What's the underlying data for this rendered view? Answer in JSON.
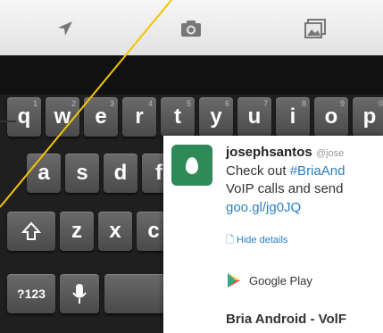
{
  "toolbar": {
    "icons": [
      "location-arrow-icon",
      "camera-icon",
      "gallery-icon"
    ]
  },
  "keyboard": {
    "row1": [
      {
        "label": "q",
        "hint": "1"
      },
      {
        "label": "w",
        "hint": "2"
      },
      {
        "label": "e",
        "hint": "3"
      },
      {
        "label": "r",
        "hint": "4"
      },
      {
        "label": "t",
        "hint": "5"
      },
      {
        "label": "y",
        "hint": "6"
      },
      {
        "label": "u",
        "hint": "7"
      },
      {
        "label": "i",
        "hint": "8"
      },
      {
        "label": "o",
        "hint": "9"
      },
      {
        "label": "p",
        "hint": "0"
      }
    ],
    "row2": [
      "a",
      "s",
      "d",
      "f"
    ],
    "row3": [
      "z",
      "x",
      "c"
    ],
    "symbols_label": "?123"
  },
  "tweet": {
    "username": "josephsantos",
    "handle": "@jose",
    "line1_prefix": "Check out ",
    "hashtag": "#BriaAnd",
    "line2": "VoIP calls and send",
    "link": "goo.gl/jg0JQ",
    "hide_details": "Hide details",
    "store": "Google Play",
    "app_title": "Bria Android - VolF"
  },
  "colors": {
    "accent_line": "#f5c400",
    "avatar": "#2e8b57",
    "link": "#2a7fc5"
  }
}
